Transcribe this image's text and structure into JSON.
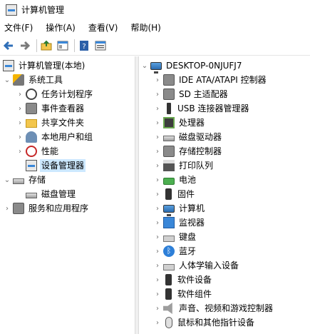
{
  "window": {
    "title": "计算机管理"
  },
  "menu": [
    "文件(F)",
    "操作(A)",
    "查看(V)",
    "帮助(H)"
  ],
  "toolbar": {
    "buttons": [
      "back-icon",
      "forward-icon",
      "up-folder-icon",
      "show-hide-tree-icon",
      "help-icon",
      "properties-icon"
    ]
  },
  "left_tree": {
    "root": "计算机管理(本地)",
    "system_tools": "系统工具",
    "task_scheduler": "任务计划程序",
    "event_viewer": "事件查看器",
    "shared_folders": "共享文件夹",
    "local_users": "本地用户和组",
    "performance": "性能",
    "device_manager": "设备管理器",
    "storage": "存储",
    "disk_management": "磁盘管理",
    "services": "服务和应用程序"
  },
  "right_tree": {
    "computer_name": "DESKTOP-0NJUFJ7",
    "categories": [
      "IDE ATA/ATAPI 控制器",
      "SD 主适配器",
      "USB 连接器管理器",
      "处理器",
      "磁盘驱动器",
      "存储控制器",
      "打印队列",
      "电池",
      "固件",
      "计算机",
      "监视器",
      "键盘",
      "蓝牙",
      "人体学输入设备",
      "软件设备",
      "软件组件",
      "声音、视频和游戏控制器",
      "鼠标和其他指针设备"
    ]
  }
}
